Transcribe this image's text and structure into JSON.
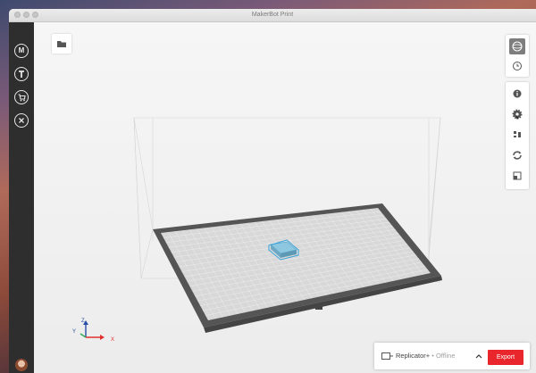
{
  "window": {
    "title": "MakerBot Print"
  },
  "sidebar": {
    "items": [
      {
        "name": "makerbot-home",
        "glyph": "M"
      },
      {
        "name": "thingiverse",
        "glyph": "T"
      },
      {
        "name": "store",
        "glyph": "cart"
      },
      {
        "name": "tools",
        "glyph": "wrench"
      }
    ]
  },
  "viewport": {
    "axes": {
      "x": "X",
      "y": "Y",
      "z": "Z"
    },
    "axis_colors": {
      "x": "#e0312e",
      "y": "#2a4da8",
      "z": "#2a4da8"
    }
  },
  "right_toolbar": {
    "top": [
      "view-mode-icon",
      "history-icon"
    ],
    "tools": [
      "info-icon",
      "settings-icon",
      "arrange-icon",
      "rotate-icon",
      "scale-icon"
    ]
  },
  "bottom_bar": {
    "printer_name": "Replicator+",
    "printer_status": " • Offline",
    "export_label": "Export"
  },
  "colors": {
    "accent": "#e8262b",
    "model": "#6fb7d6",
    "plate": "#555555"
  }
}
